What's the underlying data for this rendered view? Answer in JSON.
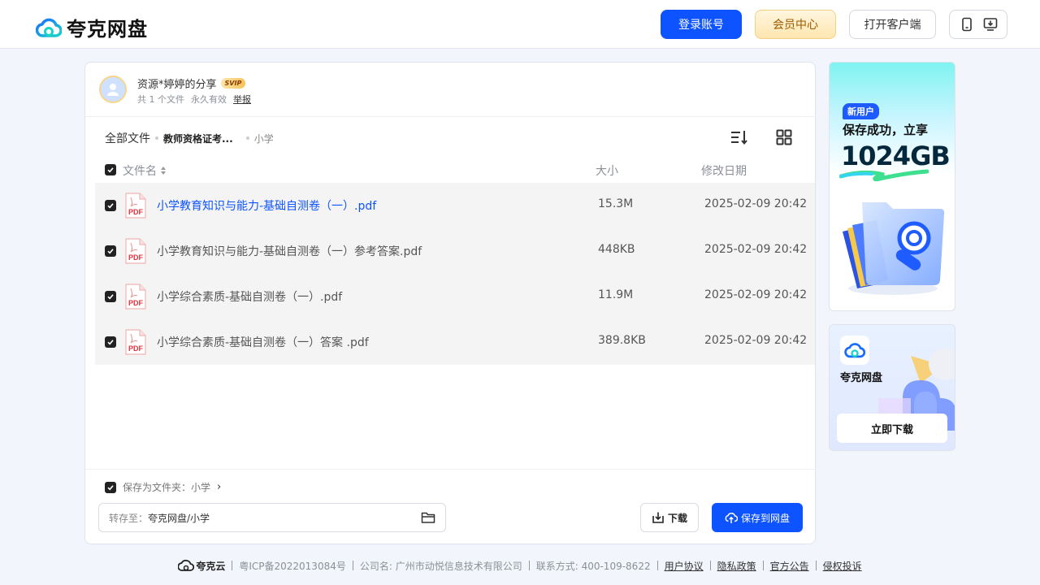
{
  "header": {
    "logo_text": "夸克网盘",
    "login_label": "登录账号",
    "vip_label": "会员中心",
    "client_label": "打开客户端"
  },
  "share": {
    "title": "资源*婷婷的分享",
    "badge": "SVIP",
    "file_count": "共 1 个文件",
    "validity": "永久有效",
    "report": "举报"
  },
  "breadcrumb": {
    "root": "全部文件",
    "mid": "教师资格证考...",
    "current": "小学"
  },
  "columns": {
    "name": "文件名",
    "size": "大小",
    "date": "修改日期"
  },
  "files": [
    {
      "name": "小学教育知识与能力-基础自测卷（一）.pdf",
      "size": "15.3M",
      "date": "2025-02-09 20:42",
      "type_label": "PDF"
    },
    {
      "name": "小学教育知识与能力-基础自测卷（一）参考答案.pdf",
      "size": "448KB",
      "date": "2025-02-09 20:42",
      "type_label": "PDF"
    },
    {
      "name": "小学综合素质-基础自测卷（一）.pdf",
      "size": "11.9M",
      "date": "2025-02-09 20:42",
      "type_label": "PDF"
    },
    {
      "name": "小学综合素质-基础自测卷（一）答案 .pdf",
      "size": "389.8KB",
      "date": "2025-02-09 20:42",
      "type_label": "PDF"
    }
  ],
  "bottom": {
    "save_as_folder": "保存为文件夹：小学",
    "path_label": "转存至：",
    "path_value": "夸克网盘/小学",
    "download_label": "下载",
    "save_label": "保存到网盘"
  },
  "ad1": {
    "tag": "新用户",
    "line1": "保存成功，立享",
    "line2": "1024GB"
  },
  "ad2": {
    "name": "夸克网盘",
    "button": "立即下载"
  },
  "footer": {
    "brand": "夸克云",
    "icp": "粤ICP备2022013084号",
    "company": "公司名: 广州市动悦信息技术有限公司",
    "contact": "联系方式: 400-109-8622",
    "links": [
      "用户协议",
      "隐私政策",
      "官方公告",
      "侵权投诉"
    ]
  },
  "colors": {
    "primary": "#0d53ff",
    "vip_bg": "#ffe6b0",
    "row_bg": "#f4f4f5"
  }
}
